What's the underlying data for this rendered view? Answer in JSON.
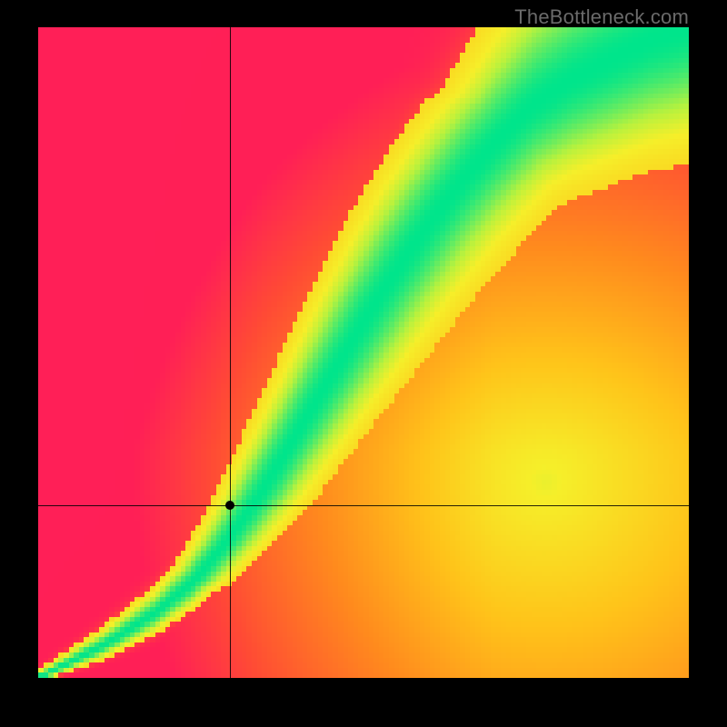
{
  "watermark": "TheBottleneck.com",
  "chart_data": {
    "type": "heatmap",
    "title": "",
    "xlabel": "",
    "ylabel": "",
    "xlim": [
      0,
      1
    ],
    "ylim": [
      0,
      1
    ],
    "grid": false,
    "legend": false,
    "ridge": {
      "x": [
        0.0,
        0.1,
        0.18,
        0.24,
        0.29,
        0.34,
        0.4,
        0.46,
        0.52,
        0.58,
        0.64,
        0.7,
        0.76,
        0.82,
        0.88,
        0.94,
        1.0
      ],
      "y": [
        0.0,
        0.05,
        0.1,
        0.15,
        0.21,
        0.28,
        0.38,
        0.48,
        0.58,
        0.67,
        0.75,
        0.82,
        0.88,
        0.92,
        0.95,
        0.98,
        1.0
      ]
    },
    "ridge_width": {
      "x": [
        0.0,
        0.2,
        0.4,
        0.6,
        0.8,
        1.0
      ],
      "w": [
        0.005,
        0.02,
        0.045,
        0.07,
        0.095,
        0.12
      ]
    },
    "background_shape": {
      "description": "Radial warm gradient centered over the lower-right interior, clipped at edges",
      "center": [
        0.78,
        0.3
      ],
      "radius_full_warm": 0.95
    },
    "crosshair": {
      "x": 0.295,
      "y": 0.265
    },
    "color_scale": {
      "stops": [
        {
          "t": 0.0,
          "color": "#ff1f57"
        },
        {
          "t": 0.18,
          "color": "#ff4b35"
        },
        {
          "t": 0.4,
          "color": "#ff8a1e"
        },
        {
          "t": 0.6,
          "color": "#ffc41a"
        },
        {
          "t": 0.78,
          "color": "#f6ef2a"
        },
        {
          "t": 0.88,
          "color": "#b9f23e"
        },
        {
          "t": 1.0,
          "color": "#00e58c"
        }
      ]
    },
    "resolution": 128
  }
}
